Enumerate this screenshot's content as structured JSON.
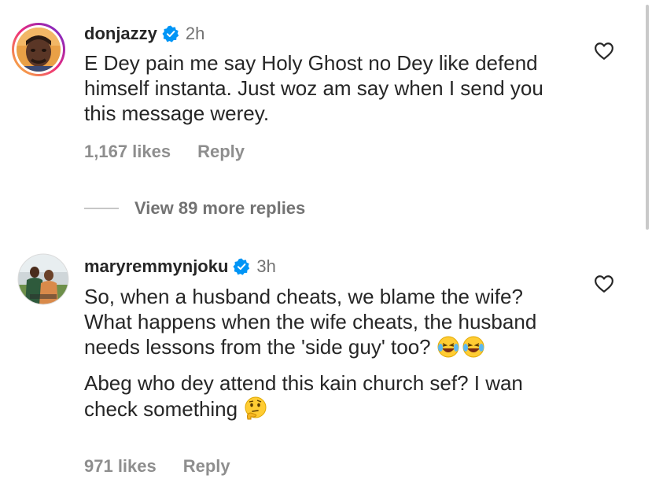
{
  "comments": [
    {
      "username": "donjazzy",
      "verified": true,
      "time": "2h",
      "lines": [
        "E Dey pain me say Holy Ghost no Dey like defend himself instanta. Just woz am say when I send you this message werey."
      ],
      "likes": "1,167 likes",
      "reply_label": "Reply",
      "view_replies": "View 89 more replies",
      "liked": false
    },
    {
      "username": "maryremmynjoku",
      "verified": true,
      "time": "3h",
      "paragraph1": "So, when a husband cheats, we blame the wife? What happens when the wife cheats, the husband needs lessons from the 'side guy' too?",
      "paragraph1_emoji": "😂😂",
      "paragraph2": "Abeg who dey attend this kain church sef? I wan check something",
      "paragraph2_emoji": "🤔",
      "likes": "971 likes",
      "reply_label": "Reply",
      "liked": false
    }
  ],
  "icons": {
    "verified": "verified-badge-icon",
    "like": "heart-outline-icon"
  },
  "colors": {
    "text": "#262626",
    "secondary": "#737373",
    "meta": "#8e8e8e",
    "verified": "#0095f6",
    "story_ring_start": "#f9ce34",
    "story_ring_mid": "#ee2a7b",
    "story_ring_end": "#6228d7"
  }
}
